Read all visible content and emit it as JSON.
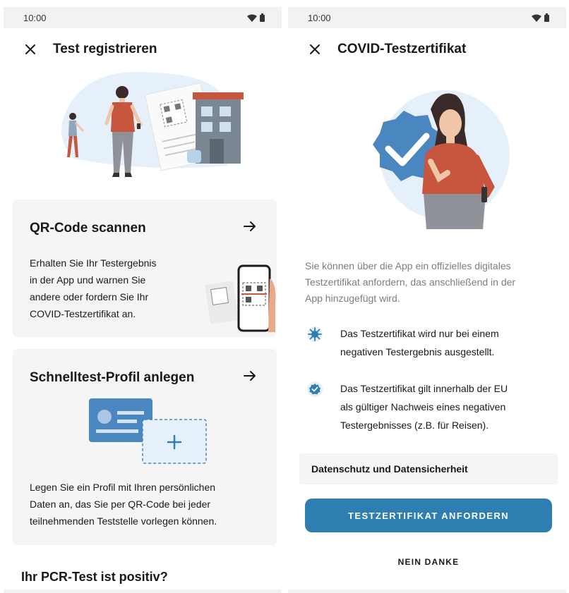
{
  "left": {
    "status_time": "10:00",
    "title": "Test registrieren",
    "qr_card": {
      "title": "QR-Code scannen",
      "body_lines": [
        "Erhalten Sie Ihr Testergebnis",
        "in der App und warnen Sie",
        "andere oder fordern Sie Ihr",
        "COVID-Testzertifikat an."
      ]
    },
    "profile_card": {
      "title": "Schnelltest-Profil anlegen",
      "body_lines": [
        "Legen Sie ein Profil mit Ihren persönlichen",
        "Daten an, das Sie per QR-Code bei jeder",
        "teilnehmenden Teststelle vorlegen können."
      ]
    },
    "section_title": "Ihr PCR-Test ist positiv?"
  },
  "right": {
    "status_time": "10:00",
    "title": "COVID-Testzertifikat",
    "intro_lines": [
      "Sie können über die App ein offizielles digitales",
      "Testzertifikat anfordern, das anschließend in der",
      "App hinzugefügt wird."
    ],
    "bullets": [
      {
        "icon": "virus-icon",
        "lines": [
          "Das Testzertifikat wird nur bei einem",
          "negativen Testergebnis ausgestellt."
        ]
      },
      {
        "icon": "verified-check-icon",
        "lines": [
          "Das Testzertifikat gilt innerhalb der EU",
          "als gültiger Nachweis eines negativen",
          "Testergebnisses (z.B. für Reisen)."
        ]
      }
    ],
    "privacy_label": "Datenschutz und Datensicherheit",
    "primary_button": "TESTZERTIFIKAT ANFORDERN",
    "secondary_button": "NEIN DANKE"
  },
  "colors": {
    "accent": "#2f7eb2",
    "card_background": "#f5f5f5",
    "illustration_blue": "#e6f0fa",
    "person_top": "#c8553d",
    "building": "#7b8793"
  }
}
